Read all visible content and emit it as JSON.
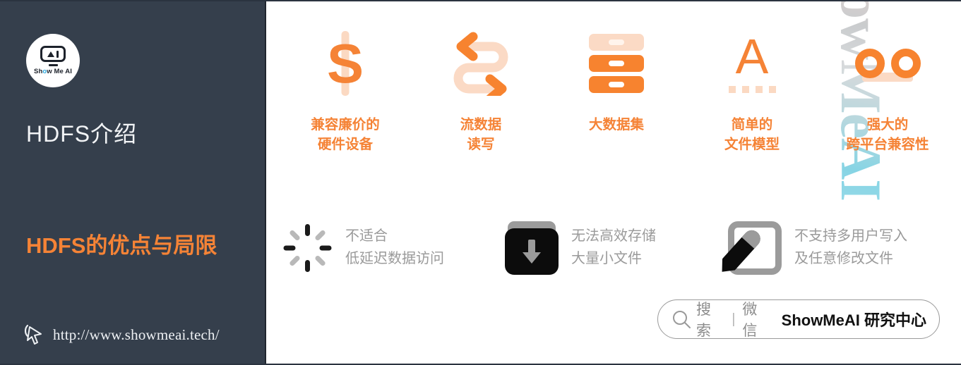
{
  "colors": {
    "sidebar_bg": "#353f4c",
    "accent_orange": "#f58336",
    "accent_light": "#fbd9c2",
    "muted_gray": "#9a9a9a",
    "white": "#ffffff"
  },
  "sidebar": {
    "logo": {
      "icon": "showmeai-robot-logo",
      "wordmark_before": "Sh",
      "wordmark_dot": "o",
      "wordmark_after": "w Me AI"
    },
    "title_primary": "HDFS介绍",
    "title_secondary": "HDFS的优点与局限",
    "footer": {
      "icon": "cursor-pointer-icon",
      "url": "http://www.showmeai.tech/"
    }
  },
  "main": {
    "watermark": "ShowMeAI",
    "features": [
      {
        "icon": "dollar-sign-icon",
        "glyph": "S",
        "line1": "兼容廉价的",
        "line2": "硬件设备"
      },
      {
        "icon": "stream-arrows-icon",
        "line1": "流数据",
        "line2": "读写"
      },
      {
        "icon": "database-stack-icon",
        "line1": "大数据集",
        "line2": ""
      },
      {
        "icon": "letter-a-icon",
        "glyph": "A",
        "line1": "简单的",
        "line2": "文件模型"
      },
      {
        "icon": "two-rings-icon",
        "line1": "强大的",
        "line2": "跨平台兼容性"
      }
    ],
    "limitations": [
      {
        "icon": "loading-spinner-icon",
        "line1": "不适合",
        "line2": "低延迟数据访问"
      },
      {
        "icon": "download-box-icon",
        "line1": "无法高效存储",
        "line2": "大量小文件"
      },
      {
        "icon": "edit-pencil-icon",
        "line1": "不支持多用户写入",
        "line2": "及任意修改文件"
      }
    ],
    "search_pill": {
      "icon": "search-icon",
      "search_label": "搜索",
      "separator": "|",
      "channel_label": "微信",
      "brand_label": "ShowMeAI 研究中心"
    }
  }
}
